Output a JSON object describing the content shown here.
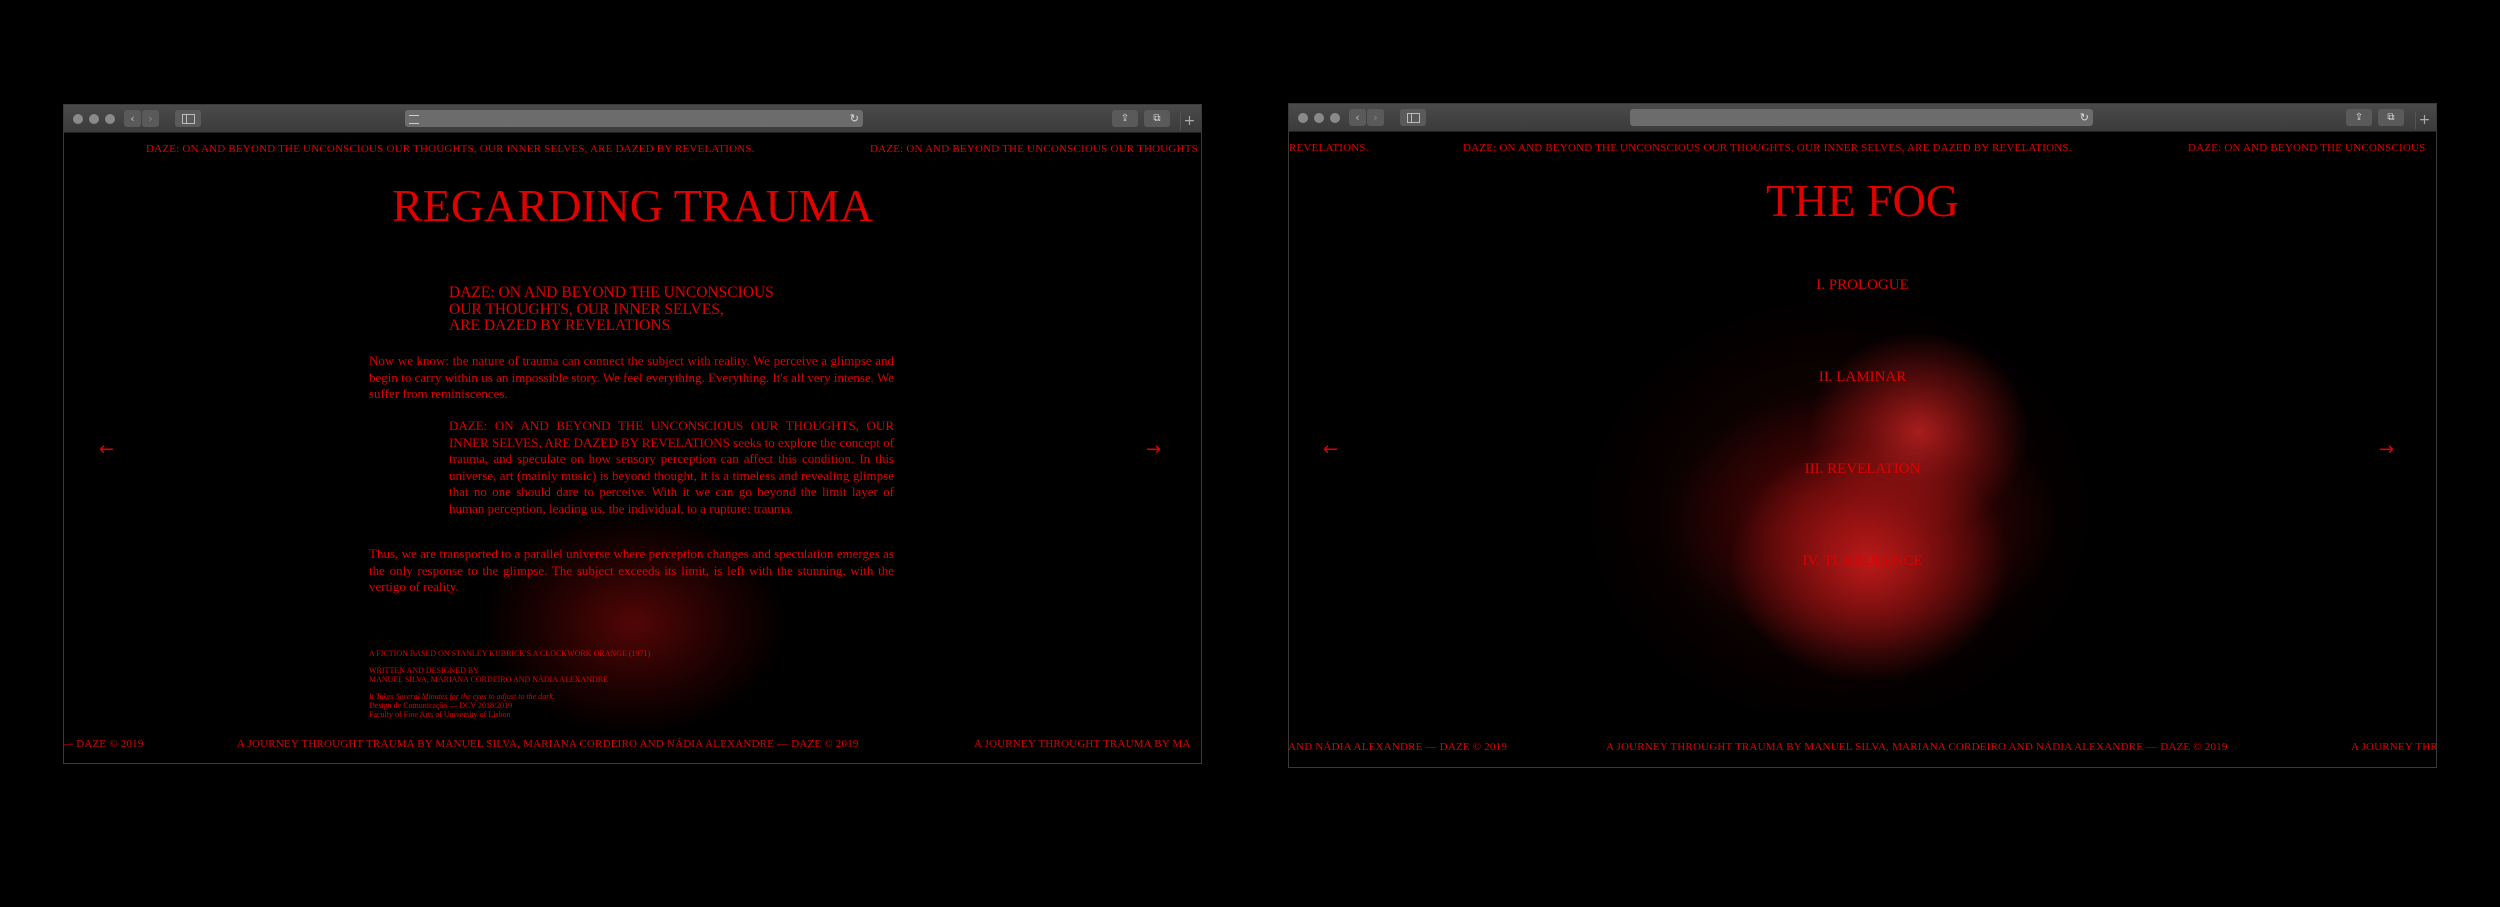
{
  "window1": {
    "marquee_top": [
      "DAZE: ON AND BEYOND THE UNCONSCIOUS OUR THOUGHTS, OUR INNER SELVES, ARE DAZED BY REVELATIONS.",
      "DAZE: ON AND BEYOND THE UNCONSCIOUS OUR THOUGHTS"
    ],
    "title": "REGARDING TRAUMA",
    "subtitle": [
      "DAZE: ON AND BEYOND THE UNCONSCIOUS",
      "OUR THOUGHTS, OUR INNER SELVES,",
      "ARE DAZED BY REVELATIONS"
    ],
    "paragraph1": "Now we know: the nature of trauma can connect the subject with reality. We perceive a glimpse and begin to carry within us an impossible story. We feel everything. Everything. It's all very intense. We suffer from reminiscences.",
    "paragraph2": "DAZE: ON AND BEYOND THE UNCONSCIOUS OUR THOUGHTS, OUR INNER SELVES, ARE DAZED BY REVELATIONS seeks to explore the concept of trauma, and speculate on how sensory perception can affect this condition. In this universe, art (mainly music) is beyond thought, it is a timeless and revealing glimpse that no one should dare to perceive. With it we can go beyond the limit layer of human perception, leading us, the individual, to a rupture: trauma.",
    "paragraph3": "Thus, we are transported to a parallel universe where perception changes and speculation emerges as the only response to the glimpse. The subject exceeds its limit, is left with the stunning, with the vertigo of reality.",
    "credits": {
      "line1": "A FICTION BASED ON STANLEY KUBRICK'S A CLOCKWORK ORANGE (1971)",
      "line2": "WRITTEN AND DESIGNED BY",
      "line3": "MANUEL SILVA, MARIANA CORDEIRO AND NÁDIA ALEXANDRE",
      "line4": "It Takes Several Minutes for the eyes to adjust to the dark.",
      "line5": "Design de Comunicação — DCV 2018/2019",
      "line6": "Faculty of Fine Arts of University of Lisbon"
    },
    "arrow_left": "←",
    "arrow_right": "→",
    "marquee_bottom": [
      "— DAZE © 2019",
      "A JOURNEY THROUGHT TRAUMA BY MANUEL SILVA, MARIANA CORDEIRO AND NÁDIA ALEXANDRE — DAZE © 2019",
      "A JOURNEY THROUGHT TRAUMA BY MA"
    ]
  },
  "window2": {
    "marquee_top": [
      "REVELATIONS.",
      "DAZE: ON AND BEYOND THE UNCONSCIOUS OUR THOUGHTS, OUR INNER SELVES, ARE DAZED BY REVELATIONS.",
      "DAZE: ON AND BEYOND THE UNCONSCIOUS"
    ],
    "title": "THE FOG",
    "menu": [
      "I. PROLOGUE",
      "II. LAMINAR",
      "III. REVELATION",
      "IV. TURBULENCE"
    ],
    "arrow_left": "←",
    "arrow_right": "→",
    "marquee_bottom": [
      "AND NÁDIA ALEXANDRE — DAZE © 2019",
      "A JOURNEY THROUGHT TRAUMA BY MANUEL SILVA, MARIANA CORDEIRO AND NÁDIA ALEXANDRE — DAZE © 2019",
      "A JOURNEY THR"
    ]
  },
  "browser": {
    "back_icon": "‹",
    "forward_icon": "›",
    "reload_icon": "↻",
    "share_icon": "⇪",
    "tabs_icon": "⧉",
    "new_tab_icon": "+"
  },
  "colors": {
    "accent": "#e00000",
    "background": "#000000"
  }
}
